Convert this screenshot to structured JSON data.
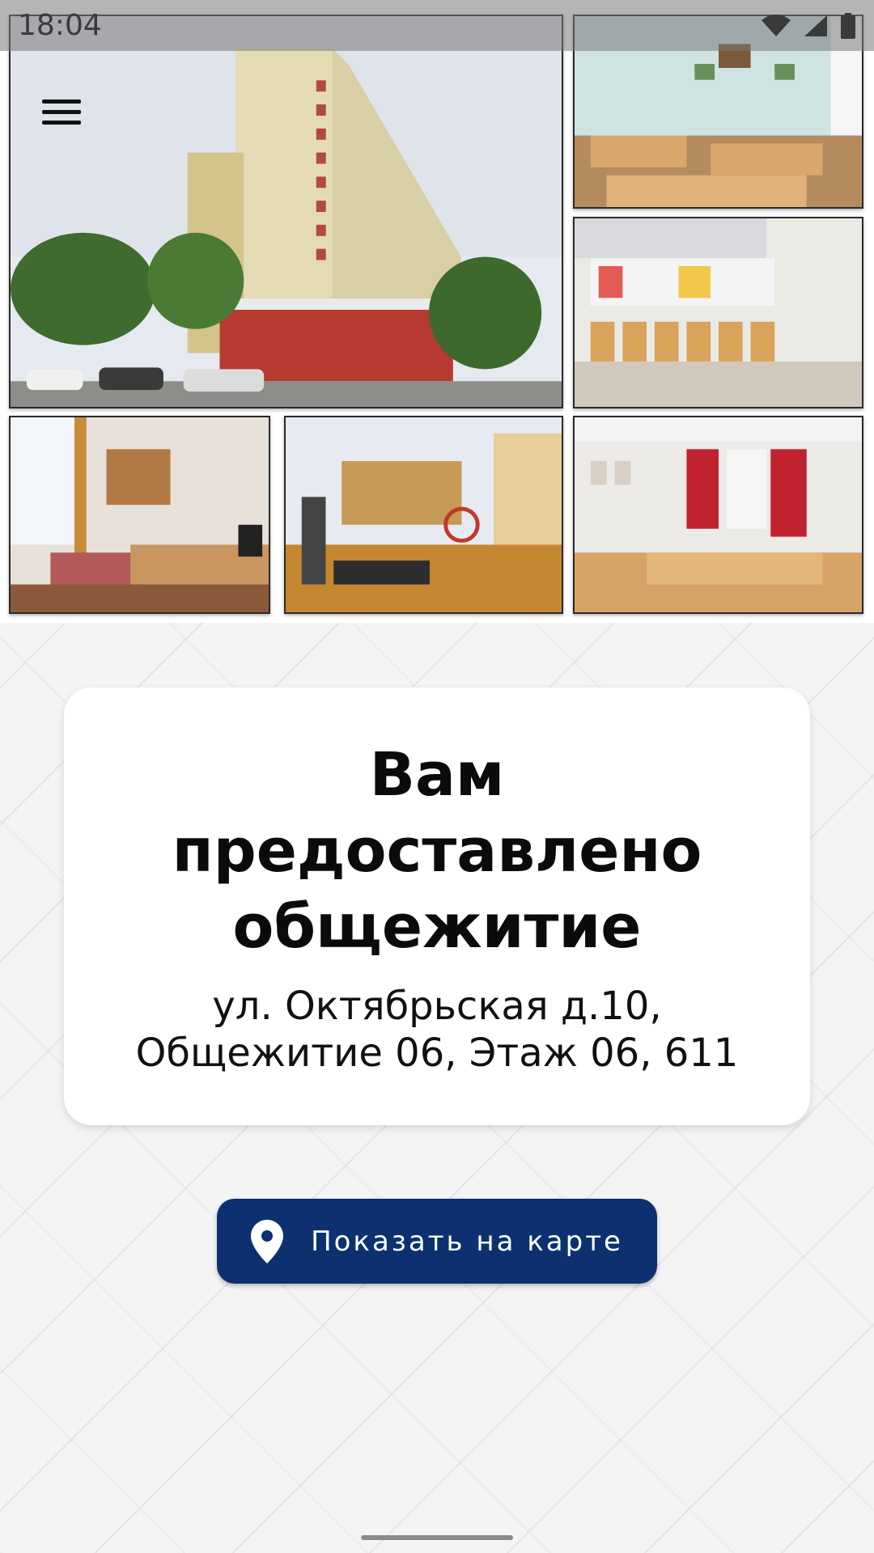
{
  "status_bar": {
    "time": "18:04",
    "icons": [
      "wifi-icon",
      "signal-icon",
      "battery-icon"
    ]
  },
  "header": {
    "menu_icon": "hamburger-menu-icon"
  },
  "gallery": [
    "dormitory-building-photo",
    "study-room-photo",
    "hallway-lounge-photo",
    "bedroom-photo",
    "gym-photo",
    "meeting-room-photo"
  ],
  "card": {
    "title": "Вам предоставлено общежитие",
    "address_line1": "ул. Октябрьская д.10,",
    "address_line2": "Общежитие 06, Этаж 06, 611"
  },
  "map_button": {
    "label": "Показать на карте",
    "icon": "map-pin-icon"
  },
  "colors": {
    "button_bg": "#0d3170",
    "card_bg": "#ffffff",
    "page_bg": "#f4f4f5"
  }
}
